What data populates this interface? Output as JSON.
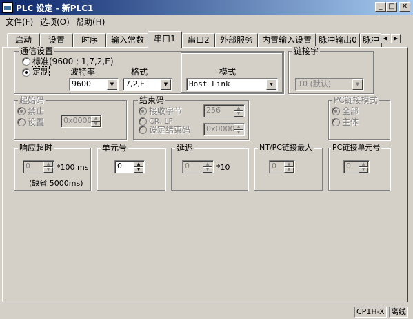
{
  "window": {
    "title": "PLC 设定 - 新PLC1",
    "min": "_",
    "max": "□",
    "close": "✕"
  },
  "menu": {
    "file": "文件(F)",
    "options": "选项(O)",
    "help": "帮助(H)"
  },
  "tabs": [
    "启动",
    "设置",
    "时序",
    "输入常数",
    "串口1",
    "串口2",
    "外部服务",
    "内置输入设置",
    "脉冲输出0",
    "脉冲"
  ],
  "selected_tab": "串口1",
  "comm": {
    "group": "通信设置",
    "std": "标准(9600 ; 1,7,2,E)",
    "custom": "定制",
    "baud_label": "波特率",
    "baud": "9600",
    "format_label": "格式",
    "format": "7,2,E",
    "mode_label": "模式",
    "mode": "Host Link",
    "selected": "custom"
  },
  "link": {
    "group": "链接字",
    "value": "10 (默认)"
  },
  "start_code": {
    "group": "起始码",
    "disable": "禁止",
    "set": "设置",
    "value": "0x0000"
  },
  "end_code": {
    "group": "结束码",
    "recv_bytes": "接收字节",
    "crlf": "CR, LF",
    "set_end": "设定结束码",
    "bytes_value": "256",
    "code_value": "0x0000"
  },
  "pc_link_mode": {
    "group": "PC链接模式",
    "all": "全部",
    "master": "主体"
  },
  "timeout": {
    "group": "响应超时",
    "value": "0",
    "unit": "*100 ms",
    "note": "(缺省 5000ms)"
  },
  "unit_no": {
    "group": "单元号",
    "value": "0"
  },
  "delay": {
    "group": "延迟",
    "value": "0",
    "unit": "*10"
  },
  "nt_max": {
    "group": "NT/PC链接最大",
    "value": "0"
  },
  "pc_unit": {
    "group": "PC链接单元号",
    "value": "0"
  },
  "status": {
    "model": "CP1H-X",
    "state": "离线"
  }
}
